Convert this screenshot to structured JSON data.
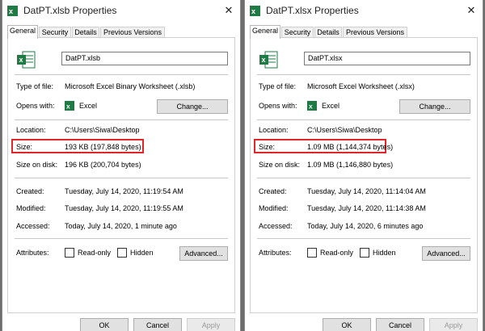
{
  "colors": {
    "excel_green": "#1d7b43",
    "highlight": "#e0252b"
  },
  "left": {
    "title": "DatPT.xlsb Properties",
    "tabs": [
      "General",
      "Security",
      "Details",
      "Previous Versions"
    ],
    "filename": "DatPT.xlsb",
    "type_label": "Type of file:",
    "type_value": "Microsoft Excel Binary Worksheet (.xlsb)",
    "opens_label": "Opens with:",
    "opens_value": "Excel",
    "change_label": "Change...",
    "location_label": "Location:",
    "location_value": "C:\\Users\\Siwa\\Desktop",
    "size_label": "Size:",
    "size_value": "193 KB (197,848 bytes)",
    "size_on_disk_label": "Size on disk:",
    "size_on_disk_value": "196 KB (200,704 bytes)",
    "created_label": "Created:",
    "created_value": "Tuesday, July 14, 2020, 11:19:54 AM",
    "modified_label": "Modified:",
    "modified_value": "Tuesday, July 14, 2020, 11:19:55 AM",
    "accessed_label": "Accessed:",
    "accessed_value": "Today, July 14, 2020, 1 minute ago",
    "attributes_label": "Attributes:",
    "readonly_label": "Read-only",
    "hidden_label": "Hidden",
    "advanced_label": "Advanced...",
    "ok_label": "OK",
    "cancel_label": "Cancel",
    "apply_label": "Apply"
  },
  "right": {
    "title": "DatPT.xlsx Properties",
    "tabs": [
      "General",
      "Security",
      "Details",
      "Previous Versions"
    ],
    "filename": "DatPT.xlsx",
    "type_label": "Type of file:",
    "type_value": "Microsoft Excel Worksheet (.xlsx)",
    "opens_label": "Opens with:",
    "opens_value": "Excel",
    "change_label": "Change...",
    "location_label": "Location:",
    "location_value": "C:\\Users\\Siwa\\Desktop",
    "size_label": "Size:",
    "size_value": "1.09 MB (1,144,374 bytes)",
    "size_on_disk_label": "Size on disk:",
    "size_on_disk_value": "1.09 MB (1,146,880 bytes)",
    "created_label": "Created:",
    "created_value": "Tuesday, July 14, 2020, 11:14:04 AM",
    "modified_label": "Modified:",
    "modified_value": "Tuesday, July 14, 2020, 11:14:38 AM",
    "accessed_label": "Accessed:",
    "accessed_value": "Today, July 14, 2020, 6 minutes ago",
    "attributes_label": "Attributes:",
    "readonly_label": "Read-only",
    "hidden_label": "Hidden",
    "advanced_label": "Advanced...",
    "ok_label": "OK",
    "cancel_label": "Cancel",
    "apply_label": "Apply"
  }
}
